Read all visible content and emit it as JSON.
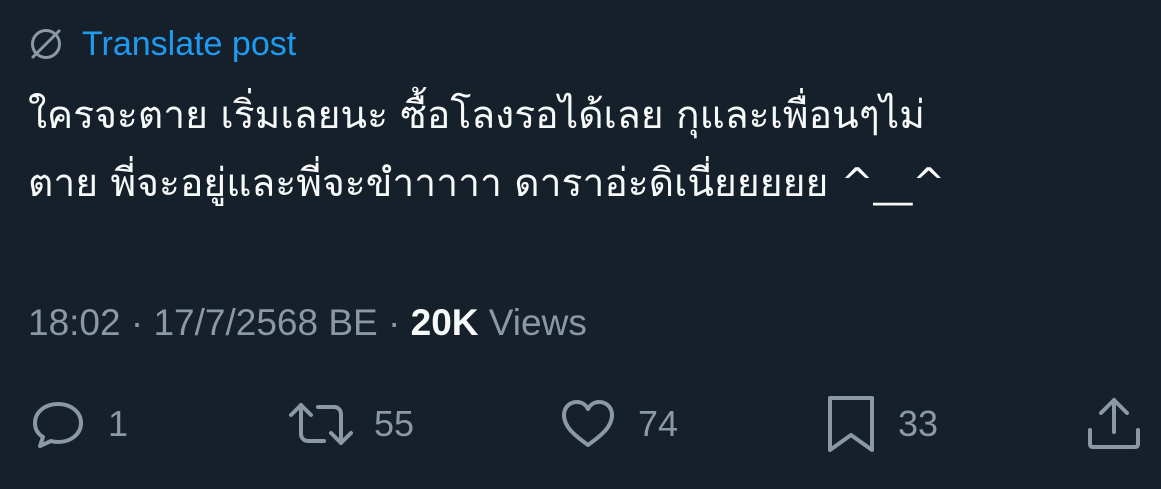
{
  "post": {
    "translate_label": "Translate post",
    "text_line1": "ใครจะตาย เริ่มเลยนะ ซื้อโลงรอได้เลย กุและเพื่อนๆไม่",
    "text_line2": "ตาย พี่จะอยู่และพี่จะขำาาาา ดาราอ่ะดิเนี่ยยยยย ^__^"
  },
  "meta": {
    "time": "18:02",
    "separator": " · ",
    "date": "17/7/2568 BE",
    "views_count": "20K",
    "views_label": " Views"
  },
  "actions": {
    "reply": {
      "icon": "reply-icon",
      "count": "1"
    },
    "repost": {
      "icon": "repost-icon",
      "count": "55"
    },
    "like": {
      "icon": "heart-icon",
      "count": "74"
    },
    "bookmark": {
      "icon": "bookmark-icon",
      "count": "33"
    },
    "share": {
      "icon": "share-icon"
    }
  },
  "colors": {
    "background": "#15202b",
    "link": "#1d9bf0",
    "text": "#f7f9f9",
    "muted": "#8b98a5"
  }
}
